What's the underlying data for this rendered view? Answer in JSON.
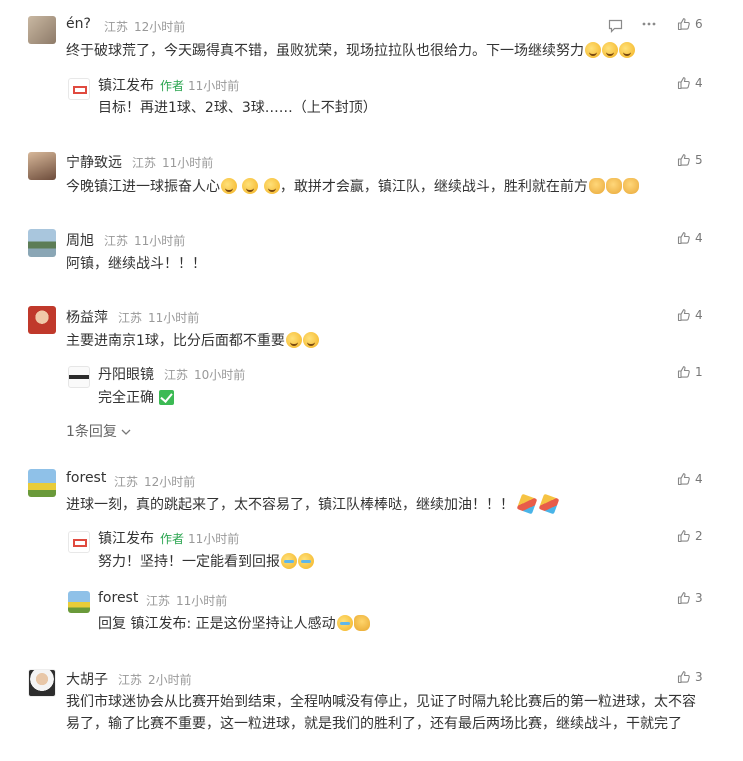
{
  "colors": {
    "author_badge": "#2aa44f",
    "meta": "#999999",
    "text": "#333333"
  },
  "comments": [
    {
      "user": "én?",
      "location": "江苏",
      "time": "12小时前",
      "likes": "6",
      "text": "终于破球荒了，今天踢得真不错，虽败犹荣，现场拉拉队也很给力。下一场继续努力",
      "replies": [
        {
          "user": "镇江发布",
          "author_badge": "作者",
          "location": "",
          "time": "11小时前",
          "likes": "4",
          "text": "目标！再进1球、2球、3球……（上不封顶）"
        }
      ]
    },
    {
      "user": "宁静致远",
      "location": "江苏",
      "time": "11小时前",
      "likes": "5",
      "text": "今晚镇江进一球振奋人心",
      "text2": "，敢拼才会赢，镇江队，继续战斗，胜利就在前方"
    },
    {
      "user": "周旭",
      "location": "江苏",
      "time": "11小时前",
      "likes": "4",
      "text": "阿镇，继续战斗！！！"
    },
    {
      "user": "杨益萍",
      "location": "江苏",
      "time": "11小时前",
      "likes": "4",
      "text": "主要进南京1球，比分后面都不重要",
      "replies": [
        {
          "user": "丹阳眼镜",
          "location": "江苏",
          "time": "10小时前",
          "likes": "1",
          "text": "完全正确"
        }
      ],
      "more_replies": "1条回复"
    },
    {
      "user": "forest",
      "location": "江苏",
      "time": "12小时前",
      "likes": "4",
      "text": "进球一刻，真的跳起来了，太不容易了，镇江队棒棒哒，继续加油！！！",
      "replies": [
        {
          "user": "镇江发布",
          "author_badge": "作者",
          "location": "",
          "time": "11小时前",
          "likes": "2",
          "text": "努力！坚持！一定能看到回报"
        },
        {
          "user": "forest",
          "location": "江苏",
          "time": "11小时前",
          "likes": "3",
          "reply_prefix": "回复",
          "reply_to": "镇江发布",
          "text": ": 正是这份坚持让人感动"
        }
      ]
    },
    {
      "user": "大胡子",
      "location": "江苏",
      "time": "2小时前",
      "likes": "3",
      "text": "我们市球迷协会从比赛开始到结束，全程呐喊没有停止，见证了时隔九轮比赛后的第一粒进球，太不容易了，输了比赛不重要，这一粒进球，就是我们的胜利了，还有最后两场比赛，继续战斗，干就完了"
    }
  ],
  "icons": {
    "like": "thumbs-up-icon",
    "reply": "comment-icon",
    "more": "more-dots-icon",
    "expand": "chevron-down-icon"
  }
}
